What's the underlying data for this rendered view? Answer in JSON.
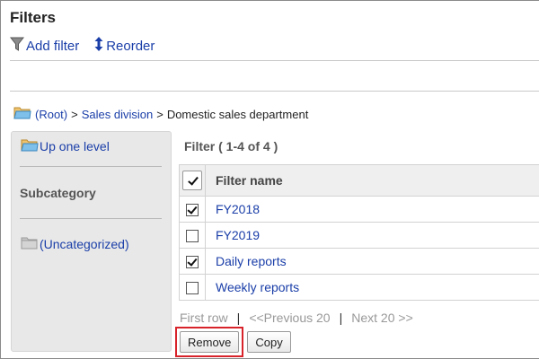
{
  "page": {
    "title": "Filters"
  },
  "toolbar": {
    "add_filter": "Add filter",
    "reorder": "Reorder"
  },
  "breadcrumb": {
    "root": "(Root)",
    "sep1": ">",
    "sales_division": "Sales division",
    "sep2": ">",
    "current": "Domestic sales department"
  },
  "sidebar": {
    "up_one_level": "Up one level",
    "subcategory_heading": "Subcategory",
    "uncategorized": "(Uncategorized)"
  },
  "list": {
    "title": "Filter ( 1-4 of 4 )",
    "column_name": "Filter name",
    "rows": [
      {
        "name": "FY2018",
        "checked": true
      },
      {
        "name": "FY2019",
        "checked": false
      },
      {
        "name": "Daily reports",
        "checked": true
      },
      {
        "name": "Weekly reports",
        "checked": false
      }
    ]
  },
  "pager": {
    "first": "First row",
    "divider": "|",
    "previous": "<<Previous 20",
    "next": "Next 20 >>"
  },
  "actions": {
    "remove": "Remove",
    "copy": "Copy"
  },
  "colors": {
    "link": "#1a3ea8",
    "highlight": "#d8232a",
    "sidebar_bg": "#e8e8e8",
    "folder": "#7ec0ea"
  },
  "icons": {
    "add_filter": "funnel-icon",
    "reorder": "vertical-arrows-icon",
    "folder": "folder-icon",
    "up": "folder-up-icon"
  }
}
